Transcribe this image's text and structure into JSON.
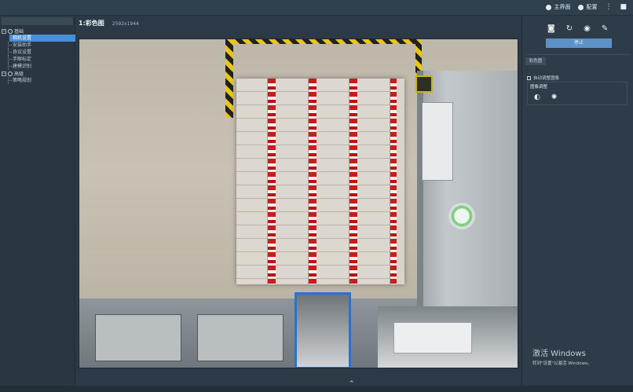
{
  "topbar": {
    "home_label": "主界面",
    "config_label": "配置",
    "more_glyph": "⋮",
    "close_glyph": "■"
  },
  "sidebar": {
    "groups": [
      {
        "label": "基础",
        "items": [
          "相机设置",
          "安装助手",
          "协议设置",
          "手眼标定",
          "建模识别"
        ]
      },
      {
        "label": "高级",
        "items": [
          "策略规划"
        ]
      }
    ],
    "active_item": "相机设置"
  },
  "viewer": {
    "title": "1:彩色图",
    "resolution": "2592x1944",
    "collapse_glyph": "⌃"
  },
  "right_panel": {
    "tools": [
      "camera-icon",
      "refresh-icon",
      "eye-icon",
      "brush-icon"
    ],
    "tool_glyphs": [
      "◙",
      "↻",
      "◉",
      "✎"
    ],
    "stop_label": "停止",
    "tab_label": "彩色图",
    "auto_adjust_label": "自动调整图像",
    "image_adjust_label": "图像调整",
    "adjust_icon_glyphs": [
      "◐",
      "✺"
    ]
  },
  "watermark": {
    "line1": "激活 Windows",
    "line2": "转到\"设置\"以激活 Windows。"
  },
  "colors": {
    "accent": "#4a90d9",
    "stop_button": "#5c92c7",
    "bin_blue": "#2f6fd0",
    "hazard_yellow": "#e9c615"
  }
}
